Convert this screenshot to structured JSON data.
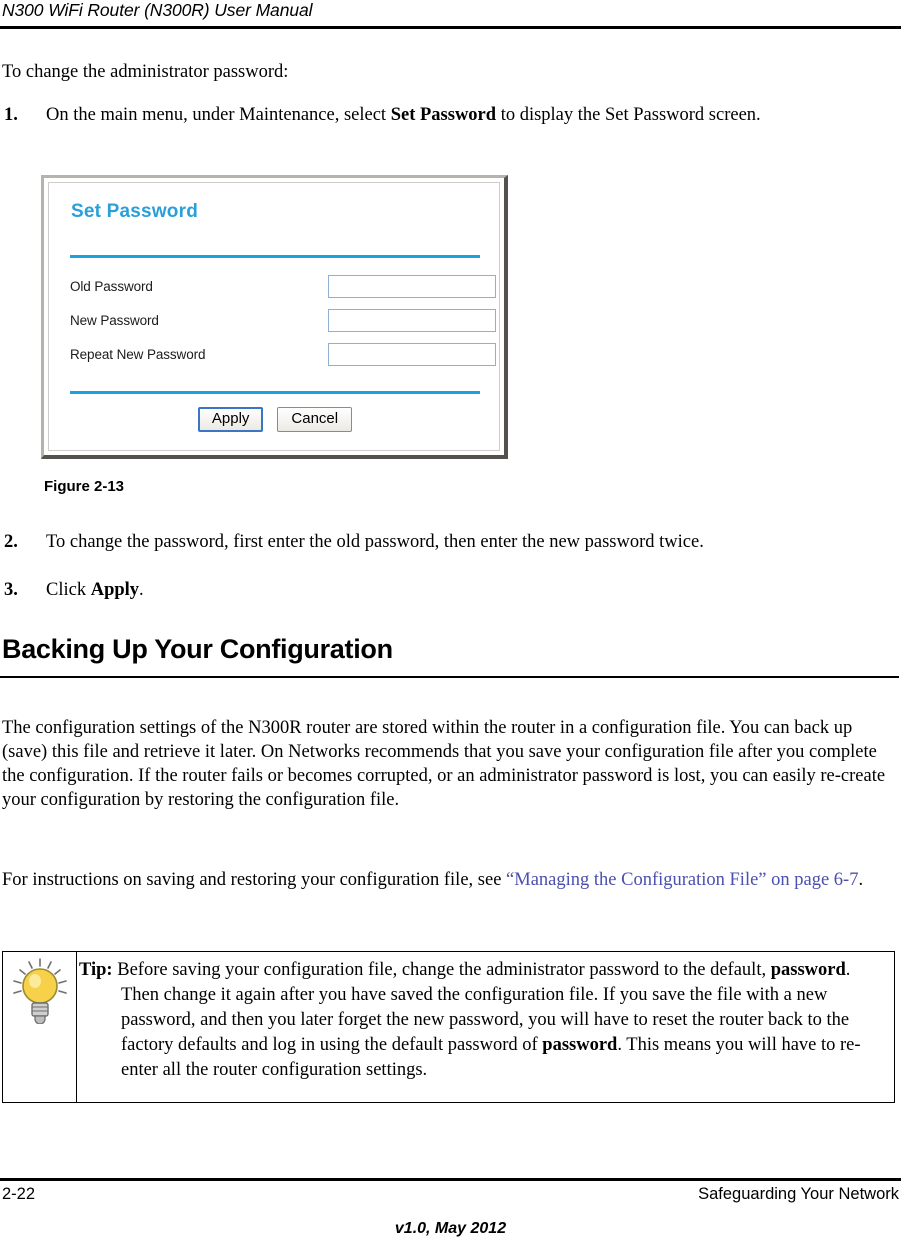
{
  "header": {
    "title": "N300 WiFi Router (N300R) User Manual"
  },
  "intro": {
    "text": "To change the administrator password:"
  },
  "steps": [
    {
      "number": "1.",
      "text_before": "On the main menu, under Maintenance, select ",
      "bold": "Set Password",
      "text_after": " to display the Set Password screen."
    },
    {
      "number": "2.",
      "text_before": "To change the password, first enter the old password, then enter the new password twice.",
      "bold": "",
      "text_after": ""
    },
    {
      "number": "3.",
      "text_before": "Click ",
      "bold": "Apply",
      "text_after": "."
    }
  ],
  "figure": {
    "caption": "Figure 2-13",
    "screenshot": {
      "title": "Set Password",
      "fields": [
        {
          "label": "Old Password",
          "value": ""
        },
        {
          "label": "New Password",
          "value": ""
        },
        {
          "label": "Repeat New Password",
          "value": ""
        }
      ],
      "buttons": [
        {
          "label": "Apply",
          "focused": true
        },
        {
          "label": "Cancel",
          "focused": false
        }
      ],
      "colors": {
        "title_blue": "#2a9fd8",
        "divider_blue": "#1ba3e0",
        "input_border": "#8fb0d3",
        "focus_ring": "#3a76c4",
        "frame_light": "#b6b3ae",
        "frame_dark": "#55524e"
      }
    }
  },
  "section": {
    "heading": "Backing Up Your Configuration",
    "paragraph_1": "The configuration settings of the N300R router are stored within the router in a configuration file. You can back up (save) this file and retrieve it later. On Networks recommends that you save your configuration file after you complete the configuration. If the router fails or becomes corrupted, or an administrator password is lost, you can easily re-create your configuration by restoring the configuration file.",
    "paragraph_2_before": "For instructions on saving and restoring your configuration file, see ",
    "paragraph_2_link": "“Managing the Configuration File” on page 6-7",
    "paragraph_2_after": ".",
    "link_color": "#4b4fae"
  },
  "tip": {
    "icon": "lightbulb-icon",
    "label": "Tip:",
    "text_part_1": " Before saving your configuration file, change the administrator password to the default, ",
    "bold_1": "password",
    "text_part_2": ". Then change it again after you have saved the configuration file. If you save the file with a new password, and then you later forget the new password, you will have to reset the router back to the factory defaults and log in using the default password of ",
    "bold_2": "password",
    "text_part_3": ". This means you will have to re-enter all the router configuration settings."
  },
  "footer": {
    "page_number": "2-22",
    "chapter_title": "Safeguarding Your Network",
    "version": "v1.0, May 2012"
  }
}
